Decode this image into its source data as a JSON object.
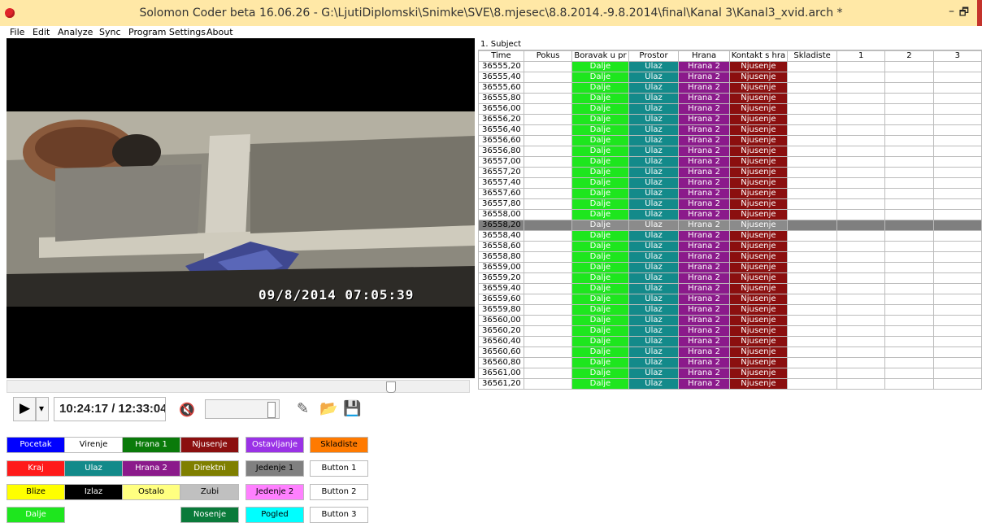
{
  "window": {
    "title": "Solomon Coder beta 16.06.26  -  G:\\LjutiDiplomski\\Snimke\\SVE\\8.mjesec\\8.8.2014.-9.8.2014\\final\\Kanal 3\\Kanal3_xvid.arch *",
    "minimize": "–",
    "maximize": "🗗"
  },
  "menu": [
    "File",
    "Edit",
    "Analyze",
    "Sync",
    "Program Settings",
    "About"
  ],
  "video": {
    "timestamp": "09/8/2014  07:05:39"
  },
  "player": {
    "play_icon": "▶",
    "dropdown_icon": "▾",
    "time": "10:24:17 / 12:33:04",
    "volume_icon": "🔇",
    "pencil_icon": "✎",
    "folder_icon": "📂",
    "save_icon": "💾",
    "volume_level": 0.9
  },
  "grid": {
    "subject": "1. Subject",
    "columns": [
      "Time",
      "Pokus",
      "Boravak u pr",
      "Prostor",
      "Hrana",
      "Kontakt s hra",
      "Skladiste",
      "1",
      "2",
      "3"
    ],
    "rows": [
      [
        "36555,20",
        "",
        "Dalje",
        "Ulaz",
        "Hrana 2",
        "Njusenje"
      ],
      [
        "36555,40",
        "",
        "Dalje",
        "Ulaz",
        "Hrana 2",
        "Njusenje"
      ],
      [
        "36555,60",
        "",
        "Dalje",
        "Ulaz",
        "Hrana 2",
        "Njusenje"
      ],
      [
        "36555,80",
        "",
        "Dalje",
        "Ulaz",
        "Hrana 2",
        "Njusenje"
      ],
      [
        "36556,00",
        "",
        "Dalje",
        "Ulaz",
        "Hrana 2",
        "Njusenje"
      ],
      [
        "36556,20",
        "",
        "Dalje",
        "Ulaz",
        "Hrana 2",
        "Njusenje"
      ],
      [
        "36556,40",
        "",
        "Dalje",
        "Ulaz",
        "Hrana 2",
        "Njusenje"
      ],
      [
        "36556,60",
        "",
        "Dalje",
        "Ulaz",
        "Hrana 2",
        "Njusenje"
      ],
      [
        "36556,80",
        "",
        "Dalje",
        "Ulaz",
        "Hrana 2",
        "Njusenje"
      ],
      [
        "36557,00",
        "",
        "Dalje",
        "Ulaz",
        "Hrana 2",
        "Njusenje"
      ],
      [
        "36557,20",
        "",
        "Dalje",
        "Ulaz",
        "Hrana 2",
        "Njusenje"
      ],
      [
        "36557,40",
        "",
        "Dalje",
        "Ulaz",
        "Hrana 2",
        "Njusenje"
      ],
      [
        "36557,60",
        "",
        "Dalje",
        "Ulaz",
        "Hrana 2",
        "Njusenje"
      ],
      [
        "36557,80",
        "",
        "Dalje",
        "Ulaz",
        "Hrana 2",
        "Njusenje"
      ],
      [
        "36558,00",
        "",
        "Dalje",
        "Ulaz",
        "Hrana 2",
        "Njusenje"
      ],
      [
        "36558,20",
        "",
        "Dalje",
        "Ulaz",
        "Hrana 2",
        "Njusenje"
      ],
      [
        "36558,40",
        "",
        "Dalje",
        "Ulaz",
        "Hrana 2",
        "Njusenje"
      ],
      [
        "36558,60",
        "",
        "Dalje",
        "Ulaz",
        "Hrana 2",
        "Njusenje"
      ],
      [
        "36558,80",
        "",
        "Dalje",
        "Ulaz",
        "Hrana 2",
        "Njusenje"
      ],
      [
        "36559,00",
        "",
        "Dalje",
        "Ulaz",
        "Hrana 2",
        "Njusenje"
      ],
      [
        "36559,20",
        "",
        "Dalje",
        "Ulaz",
        "Hrana 2",
        "Njusenje"
      ],
      [
        "36559,40",
        "",
        "Dalje",
        "Ulaz",
        "Hrana 2",
        "Njusenje"
      ],
      [
        "36559,60",
        "",
        "Dalje",
        "Ulaz",
        "Hrana 2",
        "Njusenje"
      ],
      [
        "36559,80",
        "",
        "Dalje",
        "Ulaz",
        "Hrana 2",
        "Njusenje"
      ],
      [
        "36560,00",
        "",
        "Dalje",
        "Ulaz",
        "Hrana 2",
        "Njusenje"
      ],
      [
        "36560,20",
        "",
        "Dalje",
        "Ulaz",
        "Hrana 2",
        "Njusenje"
      ],
      [
        "36560,40",
        "",
        "Dalje",
        "Ulaz",
        "Hrana 2",
        "Njusenje"
      ],
      [
        "36560,60",
        "",
        "Dalje",
        "Ulaz",
        "Hrana 2",
        "Njusenje"
      ],
      [
        "36560,80",
        "",
        "Dalje",
        "Ulaz",
        "Hrana 2",
        "Njusenje"
      ],
      [
        "36561,00",
        "",
        "Dalje",
        "Ulaz",
        "Hrana 2",
        "Njusenje"
      ],
      [
        "36561,20",
        "",
        "Dalje",
        "Ulaz",
        "Hrana 2",
        "Njusenje"
      ]
    ],
    "selected_row": 15,
    "cell_colors": {
      "Dalje": "#1ee61e",
      "Ulaz": "#138a8a",
      "Hrana 2": "#8b1a8b",
      "Njusenje": "#8b0f0f"
    }
  },
  "code_buttons": [
    {
      "label": "Pocetak",
      "bg": "#0000ff",
      "fg": "#ffffff"
    },
    {
      "label": "Virenje",
      "bg": "#ffffff",
      "fg": "#000000"
    },
    {
      "label": "Hrana 1",
      "bg": "#0a7a0a",
      "fg": "#ffffff"
    },
    {
      "label": "Njusenje",
      "bg": "#8b0f0f",
      "fg": "#ffffff"
    },
    {
      "label": "Ostavljanje",
      "bg": "#9a32e6",
      "fg": "#ffffff"
    },
    {
      "label": "Skladiste",
      "bg": "#ff7a00",
      "fg": "#000000"
    },
    {
      "label": "Kraj",
      "bg": "#ff1a1a",
      "fg": "#ffffff"
    },
    {
      "label": "Ulaz",
      "bg": "#138a8a",
      "fg": "#ffffff"
    },
    {
      "label": "Hrana 2",
      "bg": "#8b1a8b",
      "fg": "#ffffff"
    },
    {
      "label": "Direktni",
      "bg": "#7f7f00",
      "fg": "#ffffff"
    },
    {
      "label": "Jedenje 1",
      "bg": "#808080",
      "fg": "#000000"
    },
    {
      "label": "Button 1",
      "bg": "#ffffff",
      "fg": "#000000"
    },
    {
      "label": "Blize",
      "bg": "#ffff00",
      "fg": "#000000"
    },
    {
      "label": "Izlaz",
      "bg": "#000000",
      "fg": "#ffffff"
    },
    {
      "label": "Ostalo",
      "bg": "#ffff80",
      "fg": "#000000"
    },
    {
      "label": "Zubi",
      "bg": "#c0c0c0",
      "fg": "#000000"
    },
    {
      "label": "Jedenje 2",
      "bg": "#ff80ff",
      "fg": "#000000"
    },
    {
      "label": "Button 2",
      "bg": "#ffffff",
      "fg": "#000000"
    },
    {
      "label": "Dalje",
      "bg": "#1ee61e",
      "fg": "#ffffff"
    },
    {
      "label": "Nosenje",
      "bg": "#0a7a3a",
      "fg": "#ffffff"
    },
    {
      "label": "Pogled",
      "bg": "#00ffff",
      "fg": "#000000"
    },
    {
      "label": "Button 3",
      "bg": "#ffffff",
      "fg": "#000000"
    }
  ]
}
